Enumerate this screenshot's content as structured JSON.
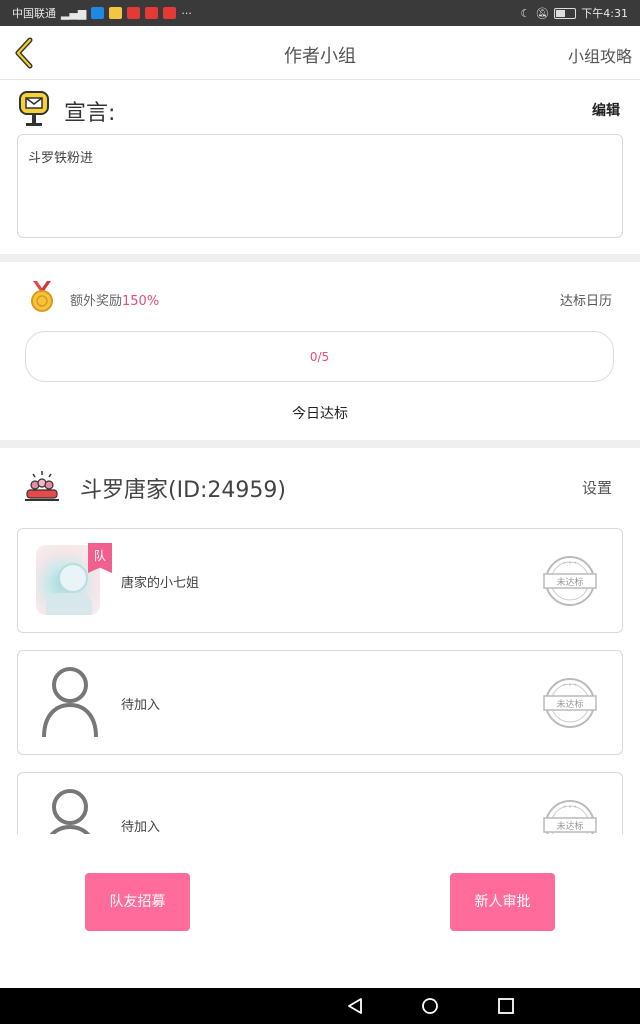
{
  "status_bar": {
    "carrier": "中国联通",
    "time": "下午4:31",
    "colors": {
      "bg": "#3a3a3a"
    }
  },
  "header": {
    "title": "作者小组",
    "right_link": "小组攻略"
  },
  "manifesto": {
    "label": "宣言:",
    "edit": "编辑",
    "text": "斗罗铁粉进"
  },
  "bonus": {
    "label": "额外奖励",
    "percent": "150%",
    "calendar_link": "达标日历",
    "progress_text": "0/5",
    "progress_fraction": 0,
    "today_button": "今日达标"
  },
  "team": {
    "name": "斗罗唐家(ID:24959)",
    "settings": "设置",
    "badge": "队",
    "members": [
      {
        "name": "唐家的小七姐",
        "status": "未达标",
        "avatar": "photo"
      },
      {
        "name": "待加入",
        "status": "未达标",
        "avatar": "person-icon"
      },
      {
        "name": "待加入",
        "status": "未达标",
        "avatar": "person-icon"
      }
    ]
  },
  "actions": {
    "recruit": "队友招募",
    "approve": "新人审批"
  },
  "colors": {
    "accent": "#ff6b9b",
    "accent_text": "#e0507a",
    "border": "#d9d9d9",
    "divider": "#efefef"
  }
}
